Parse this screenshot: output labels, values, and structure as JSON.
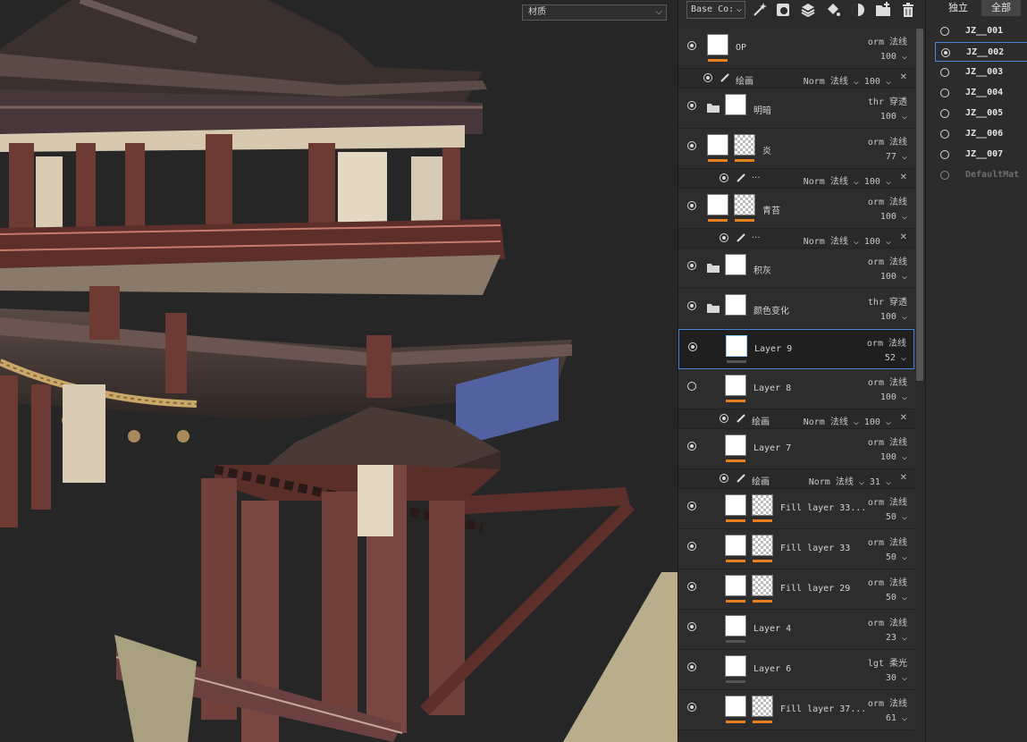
{
  "viewport": {
    "material_dropdown": "材质"
  },
  "layers_panel": {
    "channel_dropdown": "Base Co:",
    "toolbar_icons": [
      "magic-wand-icon",
      "mask-icon",
      "add-layer-icon",
      "fill-icon",
      "smart-material-icon",
      "add-folder-icon",
      "trash-icon"
    ],
    "rows": [
      {
        "type": "layer",
        "visible": true,
        "kind": "thumb",
        "name": "OP",
        "blend": "orm 法线",
        "opacity": "100",
        "bar": "#e67e22"
      },
      {
        "type": "sub",
        "visible": true,
        "name": "绘画",
        "blend": "Norm 法线",
        "opacity": "100"
      },
      {
        "type": "layer",
        "visible": true,
        "kind": "folder",
        "name": "明暗",
        "blend": "thr 穿透",
        "opacity": "100",
        "bar": "#555555"
      },
      {
        "type": "layer",
        "visible": true,
        "kind": "thumb+mask",
        "name": "炎",
        "blend": "orm 法线",
        "opacity": "77",
        "bar": "#e67e22"
      },
      {
        "type": "sub",
        "visible": true,
        "name": "···",
        "blend": "Norm 法线",
        "opacity": "100"
      },
      {
        "type": "layer",
        "visible": true,
        "kind": "thumb+mask",
        "name": "青苔",
        "blend": "orm 法线",
        "opacity": "100",
        "bar": "#e67e22"
      },
      {
        "type": "sub",
        "visible": true,
        "name": "···",
        "blend": "Norm 法线",
        "opacity": "100"
      },
      {
        "type": "layer",
        "visible": true,
        "kind": "folder",
        "name": "积灰",
        "blend": "orm 法线",
        "opacity": "100",
        "bar": "#555555"
      },
      {
        "type": "layer",
        "visible": true,
        "kind": "folder-open",
        "name": "颜色变化",
        "blend": "thr 穿透",
        "opacity": "100",
        "bar": "#555555"
      },
      {
        "type": "layer",
        "visible": true,
        "kind": "thumb",
        "name": "Layer 9",
        "blend": "orm 法线",
        "opacity": "52",
        "bar": "#555555",
        "selected": true
      },
      {
        "type": "layer",
        "visible": false,
        "kind": "thumb",
        "name": "Layer 8",
        "blend": "orm 法线",
        "opacity": "100",
        "bar": "#e67e22"
      },
      {
        "type": "sub",
        "visible": true,
        "name": "绘画",
        "blend": "Norm 法线",
        "opacity": "100"
      },
      {
        "type": "layer",
        "visible": true,
        "kind": "thumb",
        "name": "Layer 7",
        "blend": "orm 法线",
        "opacity": "100",
        "bar": "#e67e22"
      },
      {
        "type": "sub",
        "visible": true,
        "name": "绘画",
        "blend": "Norm 法线",
        "opacity": "31"
      },
      {
        "type": "layer",
        "visible": true,
        "kind": "thumb+mask",
        "name": "Fill layer 33...",
        "blend": "orm 法线",
        "opacity": "50",
        "bar": "#e67e22"
      },
      {
        "type": "layer",
        "visible": true,
        "kind": "thumb+mask",
        "name": "Fill layer 33",
        "blend": "orm 法线",
        "opacity": "50",
        "bar": "#e67e22"
      },
      {
        "type": "layer",
        "visible": true,
        "kind": "thumb+mask",
        "name": "Fill layer 29",
        "blend": "orm 法线",
        "opacity": "50",
        "bar": "#e67e22"
      },
      {
        "type": "layer",
        "visible": true,
        "kind": "thumb",
        "name": "Layer 4",
        "blend": "orm 法线",
        "opacity": "23",
        "bar": "#555555"
      },
      {
        "type": "layer",
        "visible": true,
        "kind": "thumb",
        "name": "Layer 6",
        "blend": "lgt 柔光",
        "opacity": "30",
        "bar": "#555555"
      },
      {
        "type": "layer",
        "visible": true,
        "kind": "thumb+mask",
        "name": "Fill layer 37...",
        "blend": "orm 法线",
        "opacity": "61",
        "bar": "#e67e22"
      }
    ]
  },
  "texture_set_panel": {
    "tabs": [
      "独立",
      "全部"
    ],
    "items": [
      {
        "name": "JZ__001",
        "selected": false
      },
      {
        "name": "JZ__002",
        "selected": true
      },
      {
        "name": "JZ__003",
        "selected": false
      },
      {
        "name": "JZ__004",
        "selected": false
      },
      {
        "name": "JZ__005",
        "selected": false
      },
      {
        "name": "JZ__006",
        "selected": false
      },
      {
        "name": "JZ__007",
        "selected": false
      },
      {
        "name": "DefaultMat",
        "selected": false,
        "dim": true
      }
    ]
  }
}
